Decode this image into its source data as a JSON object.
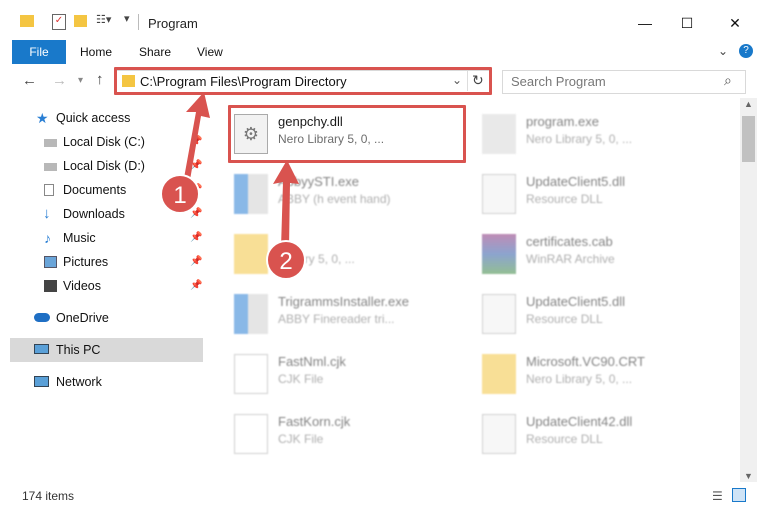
{
  "window": {
    "title": "Program"
  },
  "ribbon": {
    "file": "File",
    "home": "Home",
    "share": "Share",
    "view": "View"
  },
  "address": {
    "path": "C:\\Program Files\\Program Directory"
  },
  "search": {
    "placeholder": "Search Program"
  },
  "sidebar": {
    "items": [
      {
        "label": "Quick access"
      },
      {
        "label": "Local Disk (C:)"
      },
      {
        "label": "Local Disk (D:)"
      },
      {
        "label": "Documents"
      },
      {
        "label": "Downloads"
      },
      {
        "label": "Music"
      },
      {
        "label": "Pictures"
      },
      {
        "label": "Videos"
      },
      {
        "label": "OneDrive"
      },
      {
        "label": "This PC"
      },
      {
        "label": "Network"
      }
    ]
  },
  "files": [
    {
      "name": "genpchy.dll",
      "type": "Nero Library 5, 0, ..."
    },
    {
      "name": "program.exe",
      "type": "Nero Library 5, 0, ..."
    },
    {
      "name": "AbbyySTI.exe",
      "type": "ABBY (h event hand)"
    },
    {
      "name": "UpdateClient5.dll",
      "type": "Resource DLL"
    },
    {
      "name": "...",
      "type": "Library 5, 0, ..."
    },
    {
      "name": "certificates.cab",
      "type": "WinRAR Archive"
    },
    {
      "name": "TrigrammsInstaller.exe",
      "type": "ABBY Finereader tri..."
    },
    {
      "name": "UpdateClient5.dll",
      "type": "Resource DLL"
    },
    {
      "name": "FastNml.cjk",
      "type": "CJK File"
    },
    {
      "name": "Microsoft.VC90.CRT",
      "type": "Nero Library 5, 0, ..."
    },
    {
      "name": "FastKorn.cjk",
      "type": "CJK File"
    },
    {
      "name": "UpdateClient42.dll",
      "type": "Resource DLL"
    }
  ],
  "status": {
    "count": "174 items"
  },
  "callouts": {
    "one": "1",
    "two": "2"
  },
  "colors": {
    "accent": "#1979ca",
    "highlight": "#d9534f",
    "selected": "#d9d9d9"
  }
}
